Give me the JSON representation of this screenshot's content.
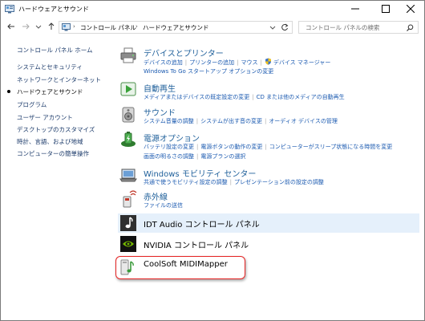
{
  "window": {
    "title": "ハードウェアとサウンド",
    "controls": {
      "minimize": "minimize",
      "maximize": "maximize",
      "close": "close"
    }
  },
  "nav": {
    "breadcrumbs": [
      "コントロール パネル",
      "ハードウェアとサウンド"
    ],
    "search_placeholder": "コントロール パネルの検索"
  },
  "sidebar": {
    "items": [
      {
        "label": "コントロール パネル ホーム",
        "current": false
      },
      {
        "label": "システムとセキュリティ",
        "current": false
      },
      {
        "label": "ネットワークとインターネット",
        "current": false
      },
      {
        "label": "ハードウェアとサウンド",
        "current": true
      },
      {
        "label": "プログラム",
        "current": false
      },
      {
        "label": "ユーザー アカウント",
        "current": false
      },
      {
        "label": "デスクトップのカスタマイズ",
        "current": false
      },
      {
        "label": "時計、言語、および地域",
        "current": false
      },
      {
        "label": "コンピューターの簡単操作",
        "current": false
      }
    ]
  },
  "categories": [
    {
      "title": "デバイスとプリンター",
      "icon": "printer-icon",
      "links_line1": [
        "デバイスの追加",
        "プリンターの追加",
        "マウス",
        "デバイス マネージャー"
      ],
      "links_line2": [
        "Windows To Go スタートアップ オプションの変更"
      ]
    },
    {
      "title": "自動再生",
      "icon": "autoplay-icon",
      "links_line1": [
        "メディアまたはデバイスの既定設定の変更",
        "CD または他のメディアの自動再生"
      ],
      "links_line2": []
    },
    {
      "title": "サウンド",
      "icon": "speaker-icon",
      "links_line1": [
        "システム音量の調整",
        "システムが出す音の変更",
        "オーディオ デバイスの管理"
      ],
      "links_line2": []
    },
    {
      "title": "電源オプション",
      "icon": "power-options-icon",
      "links_line1": [
        "バッテリ設定の変更",
        "電源ボタンの動作の変更",
        "コンピューターがスリープ状態になる時間を変更"
      ],
      "links_line2": [
        "画面の明るさの調整",
        "電源プランの選択"
      ]
    },
    {
      "title": "Windows モビリティ センター",
      "icon": "mobility-center-icon",
      "links_line1": [
        "共通で使うモビリティ設定の調整",
        "プレゼンテーション前の設定の調整"
      ],
      "links_line2": []
    },
    {
      "title": "赤外線",
      "icon": "infrared-icon",
      "links_line1": [
        "ファイルの送信"
      ],
      "links_line2": []
    }
  ],
  "rows": [
    {
      "title": "IDT Audio コントロール パネル",
      "icon": "idt-audio-icon"
    },
    {
      "title": "NVIDIA コントロール パネル",
      "icon": "nvidia-icon"
    },
    {
      "title": "CoolSoft MIDIMapper",
      "icon": "midi-mapper-icon"
    }
  ],
  "colors": {
    "link": "#1b5ab0",
    "heading": "#1e5f9a",
    "hover_row": "#e5f0fb",
    "highlight_box": "#e52222"
  }
}
